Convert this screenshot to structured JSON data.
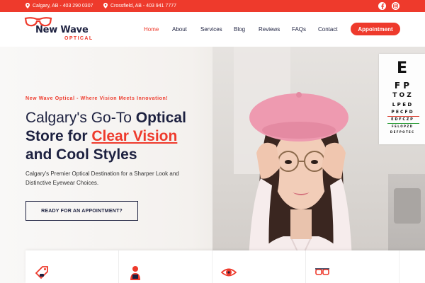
{
  "topbar": {
    "location1": "Calgary, AB - 403 290 0307",
    "location2": "Crossfield, AB - 403 941 7777",
    "social": [
      "facebook-icon",
      "instagram-icon"
    ]
  },
  "logo": {
    "name": "New Wave",
    "sub": "OPTICAL"
  },
  "nav": {
    "items": [
      "Home",
      "About",
      "Services",
      "Blog",
      "Reviews",
      "FAQs",
      "Contact"
    ],
    "active": "Home",
    "cta": "Appointment"
  },
  "hero": {
    "tagline": "New Wave Optical - Where Vision Meets Innovation!",
    "h1_line1_a": "Calgary's Go-To ",
    "h1_line1_b": "Optical",
    "h1_line2_a": "Store for ",
    "h1_line2_b": "Clear Vision",
    "h1_line3": "and Cool Styles",
    "subtitle": "Calgary's Premier Optical Destination for a Sharper Look and Distinctive Eyewear Choices.",
    "cta": "READY FOR AN APPOINTMENT?"
  },
  "eye_chart": {
    "rows": [
      "E",
      "F P",
      "T O Z",
      "L P E D",
      "P E C F D",
      "E D F C Z P",
      "F E L O P Z D",
      "D E F P O T E C"
    ]
  },
  "cards": {
    "icons": [
      "price-tag-icon",
      "person-icon",
      "eye-icon",
      "glasses-icon"
    ]
  },
  "colors": {
    "accent": "#ee3a2c",
    "navy": "#1d2140"
  }
}
